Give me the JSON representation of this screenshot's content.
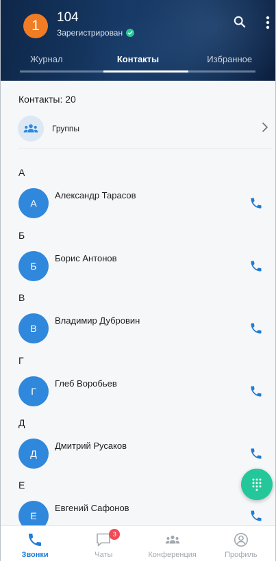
{
  "header": {
    "account_badge": "1",
    "account_number": "104",
    "status": "Зарегистрирован",
    "icons": {
      "search": "search-icon",
      "more": "more-vertical-icon",
      "status": "check-circle-icon"
    }
  },
  "tabs": [
    {
      "label": "Журнал"
    },
    {
      "label": "Контакты",
      "active": true
    },
    {
      "label": "Избранное"
    }
  ],
  "contacts": {
    "count_label": "Контакты: 20",
    "groups_label": "Группы",
    "sections": [
      {
        "letter": "А",
        "name": "Александр Тарасов",
        "initial": "А"
      },
      {
        "letter": "Б",
        "name": "Борис Антонов",
        "initial": "Б"
      },
      {
        "letter": "В",
        "name": "Владимир Дубровин",
        "initial": "В"
      },
      {
        "letter": "Г",
        "name": "Глеб Воробьев",
        "initial": "Г"
      },
      {
        "letter": "Д",
        "name": "Дмитрий Русаков",
        "initial": "Д"
      },
      {
        "letter": "Е",
        "name": "Евгений Сафонов",
        "initial": "Е"
      }
    ]
  },
  "bottom_nav": [
    {
      "label": "Звонки",
      "icon": "phone-icon",
      "active": true
    },
    {
      "label": "Чаты",
      "icon": "chat-icon",
      "badge": "3"
    },
    {
      "label": "Конференция",
      "icon": "conference-icon"
    },
    {
      "label": "Профиль",
      "icon": "profile-icon"
    }
  ],
  "colors": {
    "header": "#173a66",
    "accent": "#1f7bd6",
    "avatar": "#2f88dc",
    "account_badge": "#f07c25",
    "status_ok": "#2bc493",
    "fab": "#24c79a",
    "badge": "#f14b55"
  }
}
